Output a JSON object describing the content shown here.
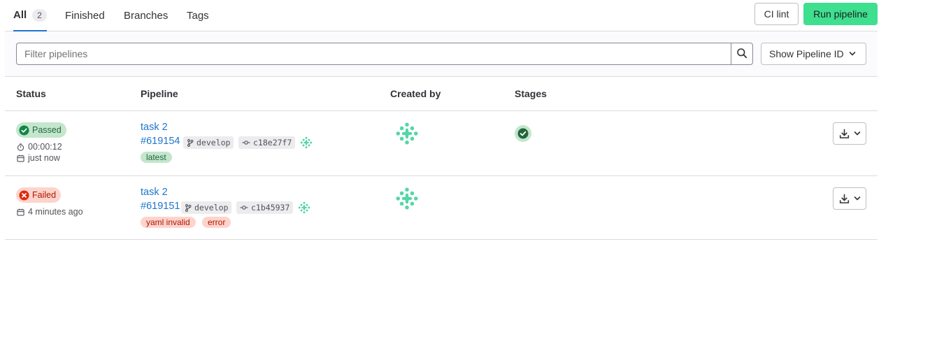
{
  "tabs": [
    {
      "label": "All",
      "count": "2"
    },
    {
      "label": "Finished"
    },
    {
      "label": "Branches"
    },
    {
      "label": "Tags"
    }
  ],
  "actions": {
    "ci_lint": "CI lint",
    "run_pipeline": "Run pipeline"
  },
  "filter": {
    "placeholder": "Filter pipelines",
    "show_id_label": "Show Pipeline ID"
  },
  "columns": {
    "status": "Status",
    "pipeline": "Pipeline",
    "created_by": "Created by",
    "stages": "Stages"
  },
  "pipelines": [
    {
      "status": "Passed",
      "duration": "00:00:12",
      "finished": "just now",
      "title": "task 2",
      "id": "#619154",
      "branch": "develop",
      "commit": "c18e27f7",
      "labels": [
        "latest"
      ]
    },
    {
      "status": "Failed",
      "finished": "4 minutes ago",
      "title": "task 2",
      "id": "#619151",
      "branch": "develop",
      "commit": "c1b45937",
      "labels": [
        "yaml invalid",
        "error"
      ]
    }
  ],
  "colors": {
    "accent": "#1f75cb",
    "run_button": "#3ee08f",
    "success": "#108548",
    "danger": "#dd2b0e",
    "avatar": "#4fd1a0"
  }
}
